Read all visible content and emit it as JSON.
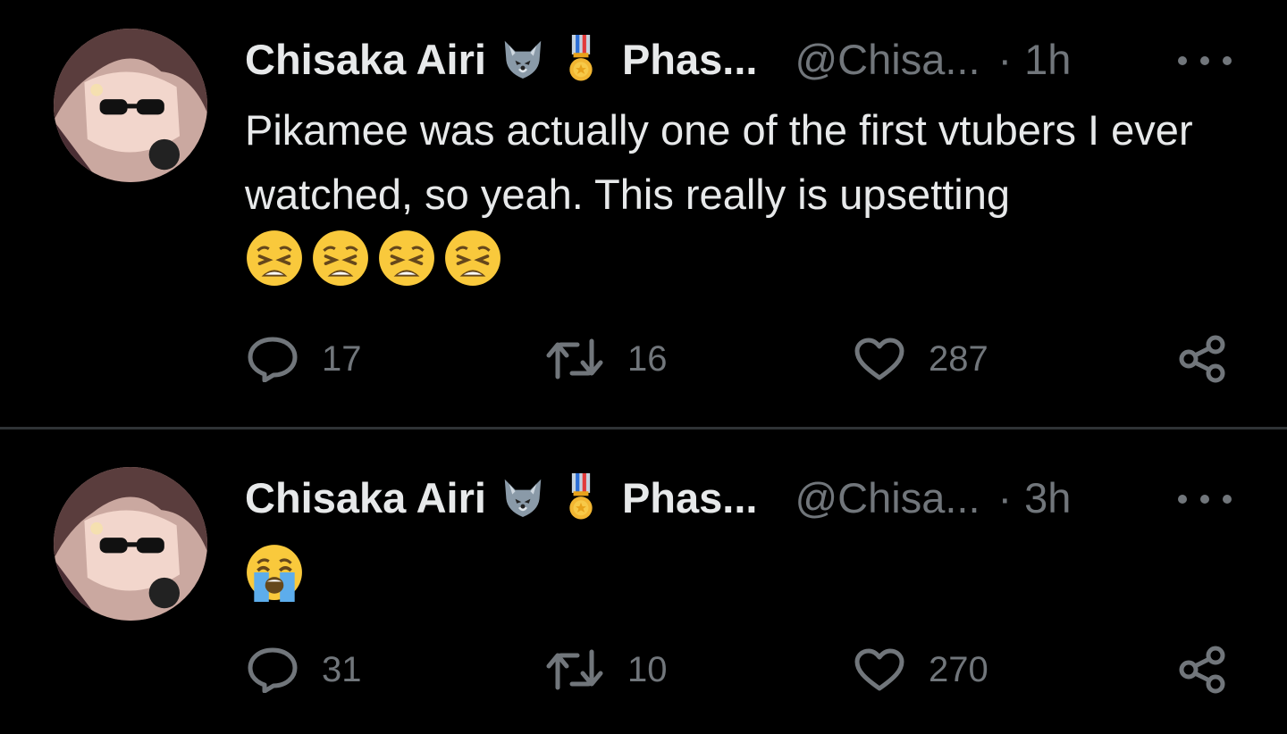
{
  "tweets": [
    {
      "display_name": "Chisaka Airi",
      "badges": [
        "wolf-emoji",
        "military-medal-emoji"
      ],
      "affiliation": "Phas...",
      "handle": "@Chisa...",
      "separator": "·",
      "time": "1h",
      "text": "Pikamee was actually one of the first vtubers I ever watched, so yeah. This really is upsetting",
      "emojis": [
        "weary-face",
        "weary-face",
        "weary-face",
        "weary-face"
      ],
      "replies": "17",
      "retweets": "16",
      "likes": "287"
    },
    {
      "display_name": "Chisaka Airi",
      "badges": [
        "wolf-emoji",
        "military-medal-emoji"
      ],
      "affiliation": "Phas...",
      "handle": "@Chisa...",
      "separator": "·",
      "time": "3h",
      "text": "",
      "emojis": [
        "loudly-crying-face"
      ],
      "replies": "31",
      "retweets": "10",
      "likes": "270"
    }
  ],
  "colors": {
    "background": "#000000",
    "primary_text": "#e7e9ea",
    "secondary_text": "#71767b",
    "divider": "#2f3336",
    "emoji_yellow": "#f9c93c"
  }
}
